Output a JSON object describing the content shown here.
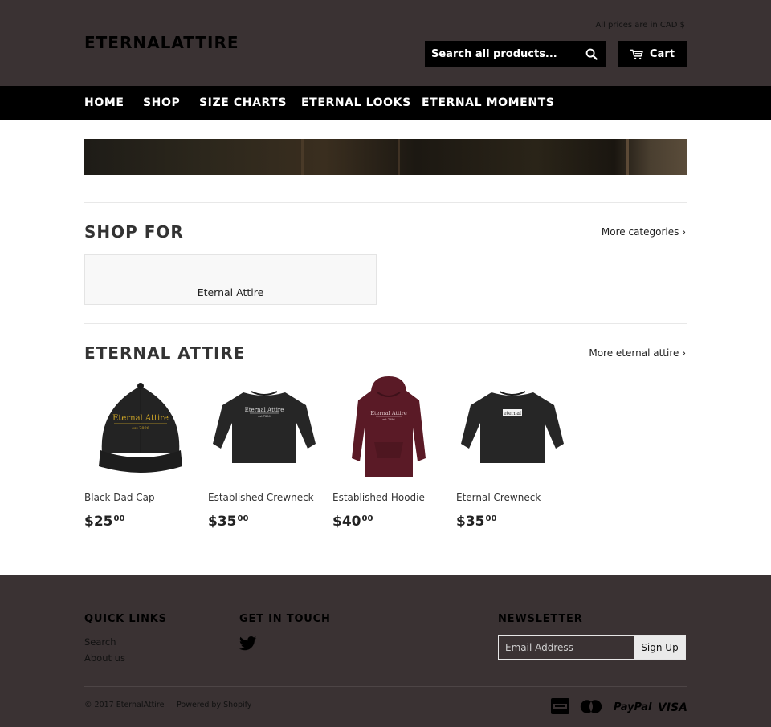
{
  "header": {
    "logo": "ETERNALATTIRE",
    "currency_note": "All prices are in CAD $",
    "search_placeholder": "Search all products...",
    "cart_label": "Cart"
  },
  "nav": {
    "items": [
      "HOME",
      "SHOP",
      "SIZE CHARTS",
      "ETERNAL LOOKS",
      "ETERNAL MOMENTS"
    ]
  },
  "shop_for": {
    "title": "SHOP FOR",
    "more_link": "More categories ›",
    "collections": [
      "Eternal Attire"
    ]
  },
  "featured": {
    "title": "ETERNAL ATTIRE",
    "more_link": "More eternal attire ›",
    "products": [
      {
        "name": "Black Dad Cap",
        "price_main": "$25",
        "price_cents": "00",
        "image": "black-cap",
        "logo_text": "Eternal Attire",
        "sub_text": "est 7896"
      },
      {
        "name": "Established Crewneck",
        "price_main": "$35",
        "price_cents": "00",
        "image": "black-crewneck",
        "logo_text": "Eternal Attire",
        "sub_text": "est 7896"
      },
      {
        "name": "Established Hoodie",
        "price_main": "$40",
        "price_cents": "00",
        "image": "maroon-hoodie",
        "logo_text": "Eternal Attire",
        "sub_text": "est 7896"
      },
      {
        "name": "Eternal Crewneck",
        "price_main": "$35",
        "price_cents": "00",
        "image": "black-crewneck-box-logo",
        "logo_text": "eternal"
      }
    ]
  },
  "footer": {
    "quick_links_title": "QUICK LINKS",
    "quick_links": [
      "Search",
      "About us"
    ],
    "get_in_touch_title": "GET IN TOUCH",
    "newsletter_title": "NEWSLETTER",
    "email_placeholder": "Email Address",
    "signup_label": "Sign Up",
    "copyright": "© 2017 EternalAttire",
    "powered_by": "Powered by Shopify",
    "payment_methods": [
      "american-express",
      "master",
      "PayPal",
      "VISA"
    ]
  },
  "colors": {
    "header_bg": "#3a3233",
    "nav_bg": "#000000",
    "footer_bg": "#3a3233",
    "hoodie": "#5a1a26",
    "cap_logo": "#c9a227"
  }
}
